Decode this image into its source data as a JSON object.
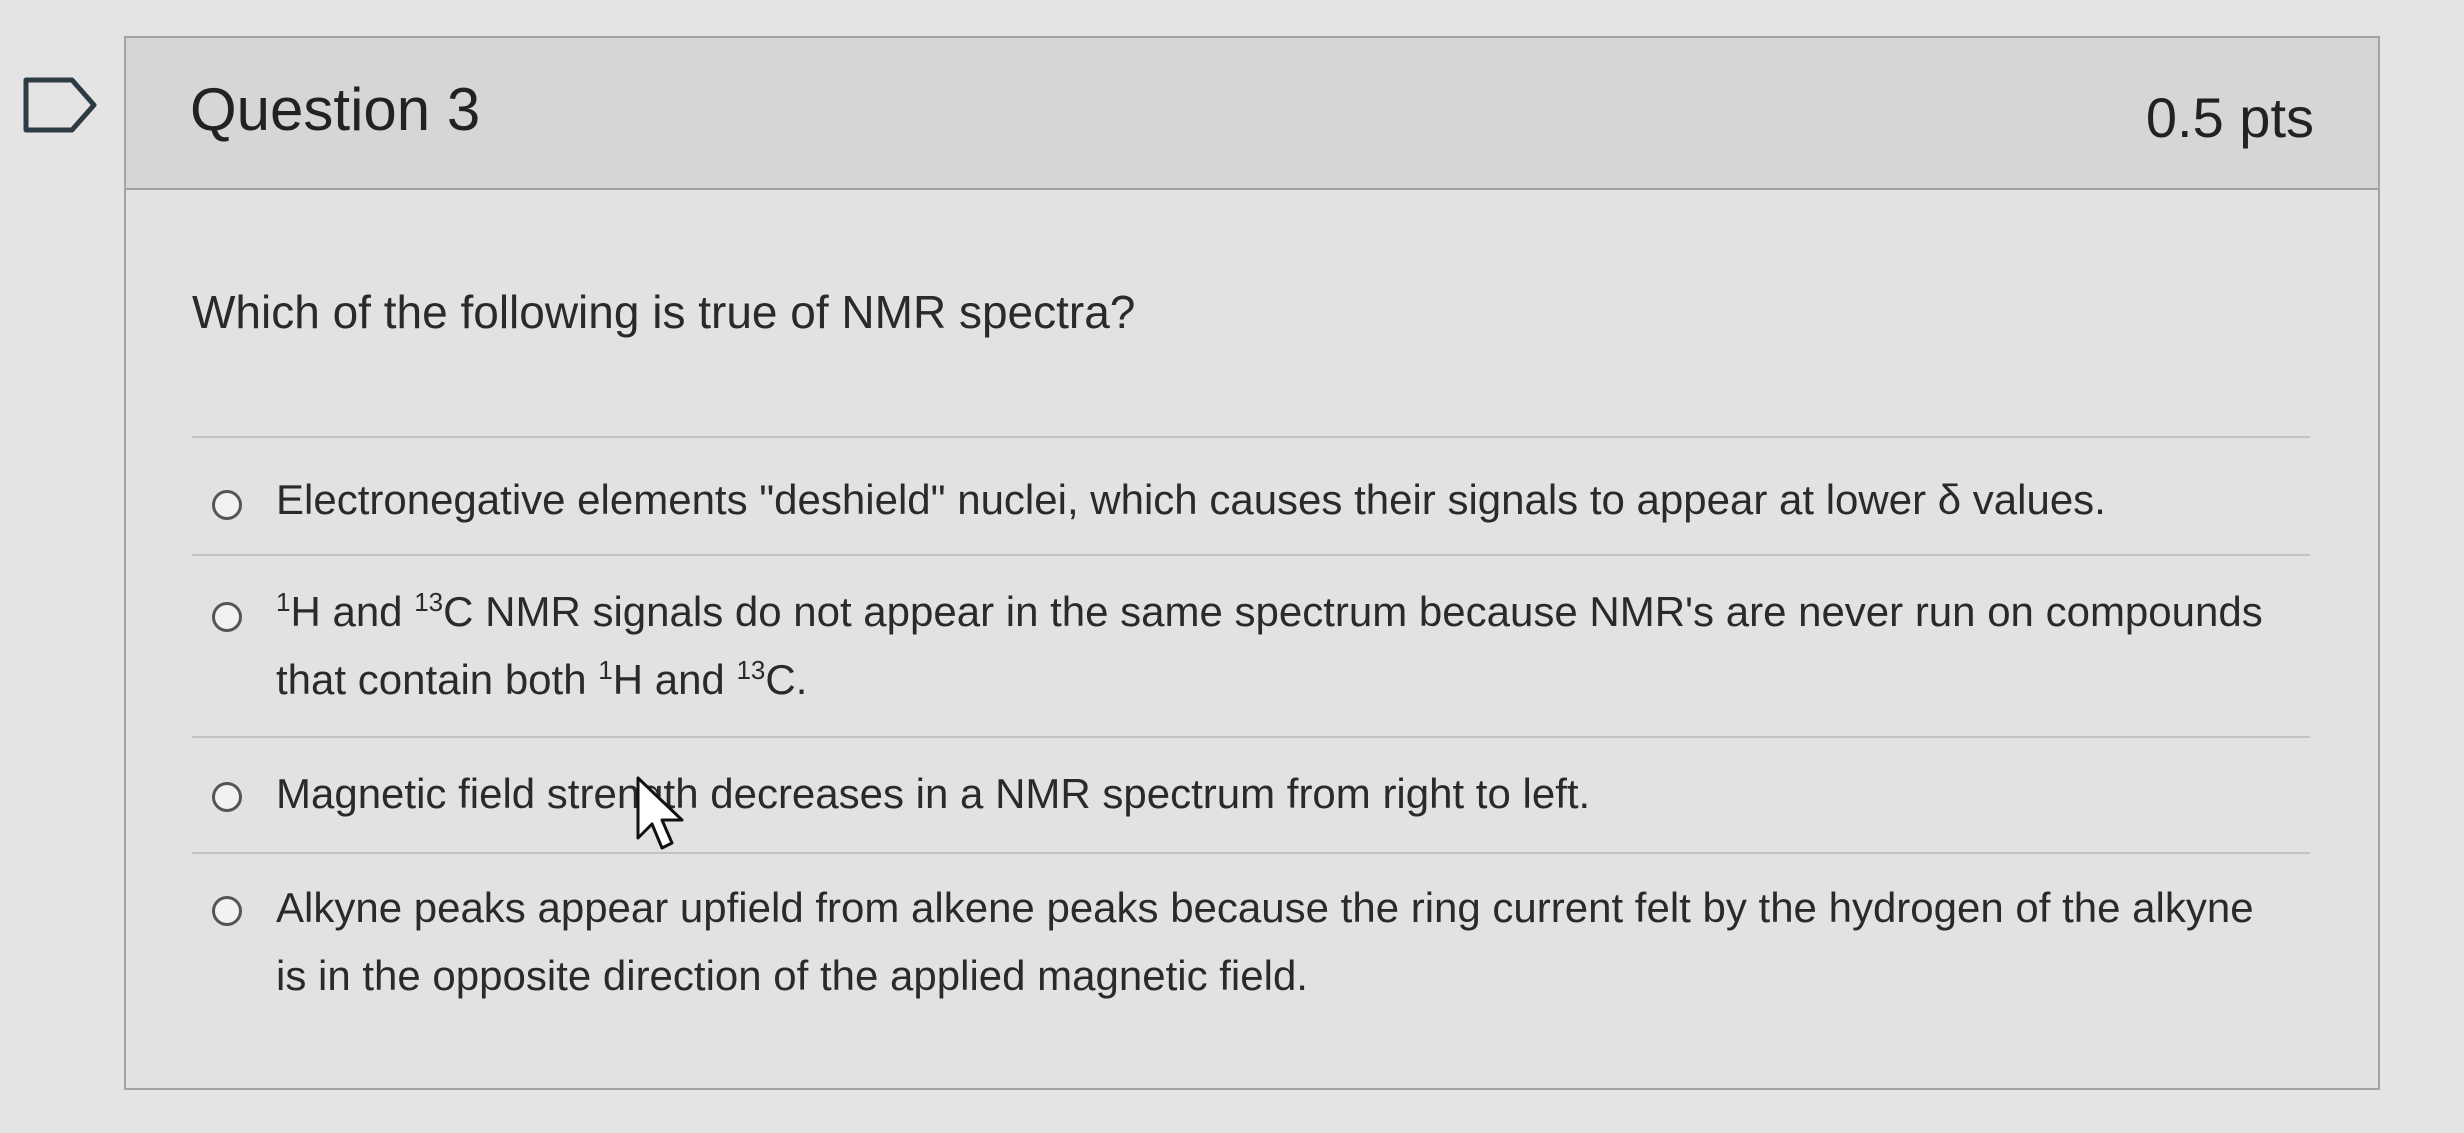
{
  "question": {
    "title": "Question 3",
    "points": "0.5 pts",
    "text": "Which of the following is true of NMR spectra?"
  },
  "answers": [
    {
      "id": "a1",
      "text": "Electronegative elements \"deshield\" nuclei, which causes their signals to appear at lower δ values.",
      "selected": false
    },
    {
      "id": "a2",
      "segments": [
        {
          "t": "sup",
          "v": "1"
        },
        {
          "t": "text",
          "v": "H and "
        },
        {
          "t": "sup",
          "v": "13"
        },
        {
          "t": "text",
          "v": "C NMR signals do not appear in the same spectrum because NMR's are never run on compounds that contain both "
        },
        {
          "t": "sup",
          "v": "1"
        },
        {
          "t": "text",
          "v": "H and "
        },
        {
          "t": "sup",
          "v": "13"
        },
        {
          "t": "text",
          "v": "C."
        }
      ],
      "selected": false
    },
    {
      "id": "a3",
      "text": "Magnetic field strength decreases in a NMR spectrum from right to left.",
      "selected": false
    },
    {
      "id": "a4",
      "text": "Alkyne peaks appear upfield from alkene peaks because the ring current felt by the hydrogen of the alkyne is in the opposite direction of the applied magnetic field.",
      "selected": false
    }
  ],
  "icons": {
    "flag": "flag-icon",
    "cursor": "mouse-cursor-icon",
    "radio": "radio-unselected-icon"
  },
  "colors": {
    "background": "#e4e4e4",
    "header": "#d6d6d6",
    "card": "#e2e2e2",
    "border": "#a3a3a3",
    "text": "#2a2a2a"
  }
}
